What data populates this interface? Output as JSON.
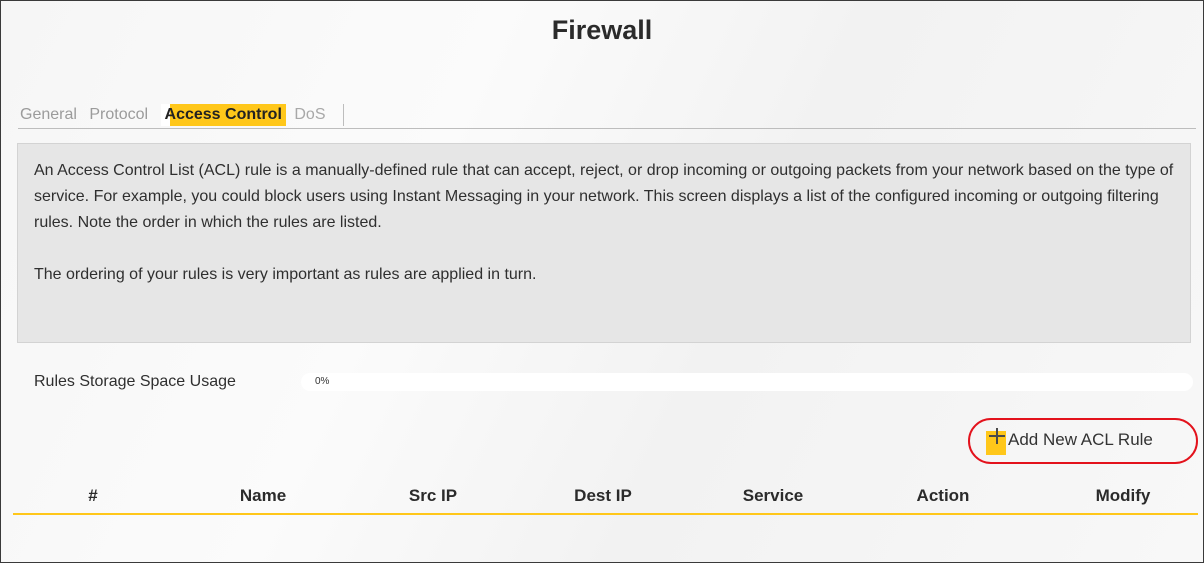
{
  "page": {
    "title": "Firewall"
  },
  "tabs": [
    {
      "label": "General",
      "active": false
    },
    {
      "label": "Protocol",
      "active": false
    },
    {
      "label": "Access Control",
      "active": true
    },
    {
      "label": "DoS",
      "active": false
    }
  ],
  "description": {
    "paragraph1": "An Access Control List (ACL) rule is a manually-defined rule that can accept, reject, or drop incoming or outgoing packets from your network based on the type of service. For example, you could block users using Instant Messaging in your network. This screen displays a list of the configured incoming or outgoing filtering rules. Note the order in which the rules are listed.",
    "paragraph2": "The ordering of your rules is very important as rules are applied in turn."
  },
  "storage": {
    "label": "Rules Storage Space Usage",
    "usage_text": "0%",
    "usage_fraction": 0
  },
  "actions": {
    "add_rule_label": "Add New ACL Rule"
  },
  "table": {
    "columns": [
      "#",
      "Name",
      "Src IP",
      "Dest IP",
      "Service",
      "Action",
      "Modify"
    ]
  },
  "colors": {
    "accent": "#ffc71a",
    "highlight_ring": "#e3121c",
    "panel": "#e6e6e6"
  },
  "icons": {
    "add": "plus-icon"
  }
}
